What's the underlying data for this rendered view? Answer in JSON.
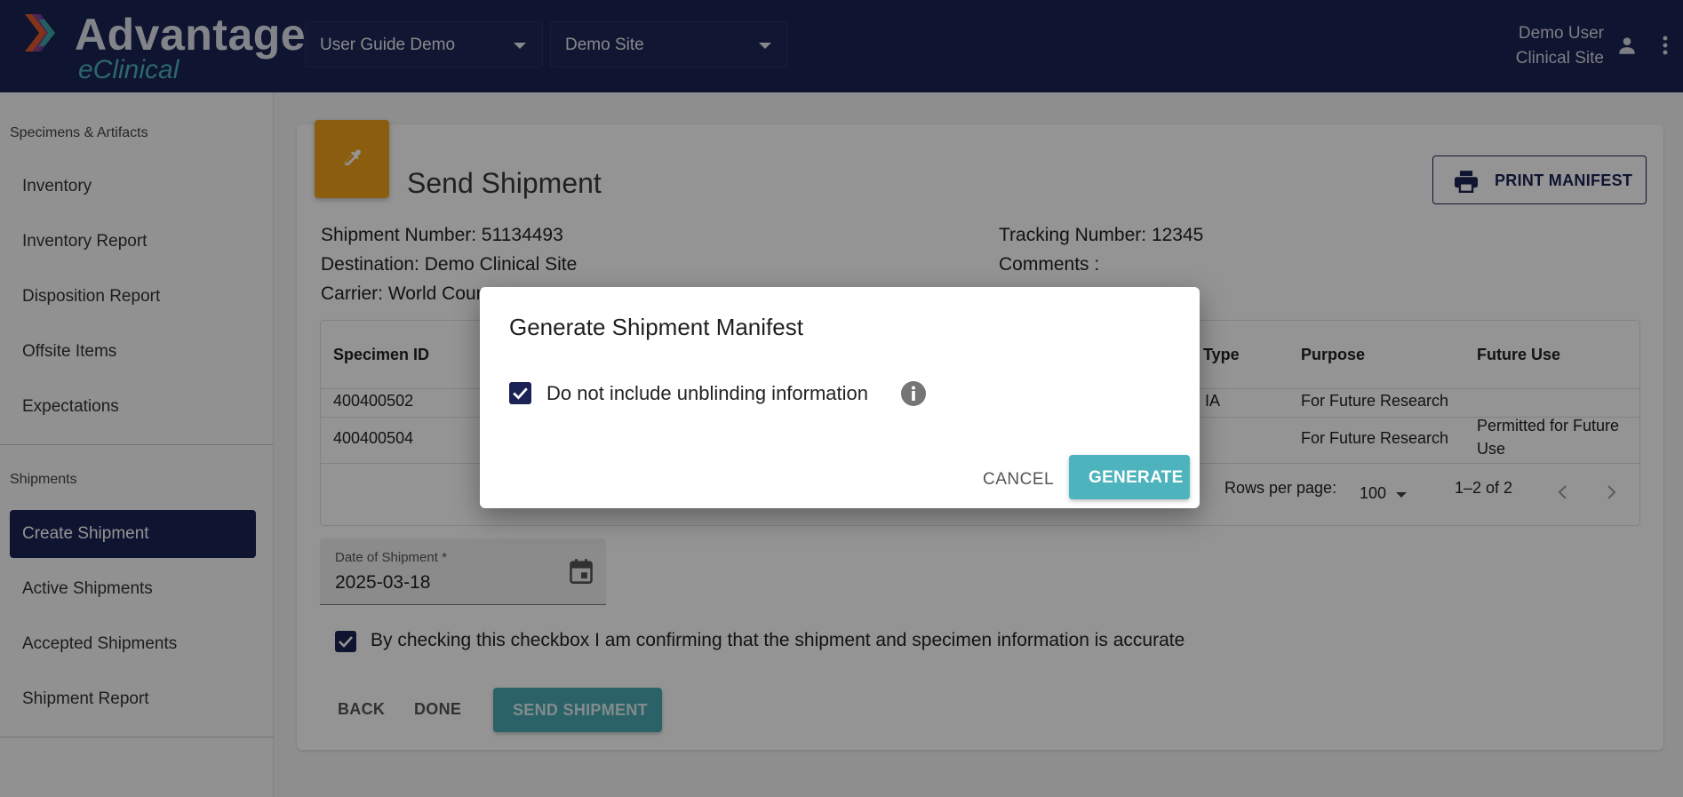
{
  "header": {
    "logo_main": "Advantage",
    "logo_sub": "eClinical",
    "study_selector": "User Guide Demo",
    "site_selector": "Demo Site",
    "user_name": "Demo User",
    "user_site": "Clinical Site"
  },
  "sidebar": {
    "section1": "Specimens & Artifacts",
    "items1": [
      "Inventory",
      "Inventory Report",
      "Disposition Report",
      "Offsite Items",
      "Expectations"
    ],
    "section2": "Shipments",
    "items2": [
      "Create Shipment",
      "Active Shipments",
      "Accepted Shipments",
      "Shipment Report"
    ],
    "active_item": "Create Shipment"
  },
  "page": {
    "title": "Send Shipment",
    "print_label": "PRINT MANIFEST",
    "shipment_number": "Shipment Number: 51134493",
    "destination": "Destination: Demo Clinical Site",
    "carrier": "Carrier: World Cour",
    "tracking_number": "Tracking Number: 12345",
    "comments": "Comments :"
  },
  "table": {
    "headers": {
      "specimen_id": "Specimen ID",
      "type": "Type",
      "purpose": "Purpose",
      "future_use": "Future Use"
    },
    "rows": [
      {
        "specimen_id": "400400502",
        "type_partial": "IA",
        "purpose": "For Future Research",
        "future_use": ""
      },
      {
        "specimen_id": "400400504",
        "type_partial": "",
        "purpose": "For Future Research",
        "future_use_line1": "Permitted for Future",
        "future_use_line2": "Use"
      }
    ],
    "rows_per_page_label": "Rows per page:",
    "rows_per_page_value": "100",
    "page_range": "1–2 of 2"
  },
  "form": {
    "date_label": "Date of Shipment *",
    "date_value": "2025-03-18",
    "confirm_label": "By checking this checkbox I am confirming that the shipment and specimen information is accurate",
    "confirm_checked": true,
    "back_label": "BACK",
    "done_label": "DONE",
    "send_label": "SEND SHIPMENT"
  },
  "dialog": {
    "title": "Generate Shipment Manifest",
    "checkbox_label": "Do not include unblinding information",
    "checkbox_checked": true,
    "cancel_label": "CANCEL",
    "generate_label": "GENERATE"
  },
  "colors": {
    "navy": "#1b2354",
    "teal": "#4db3bc",
    "orange": "#f0a21a"
  }
}
